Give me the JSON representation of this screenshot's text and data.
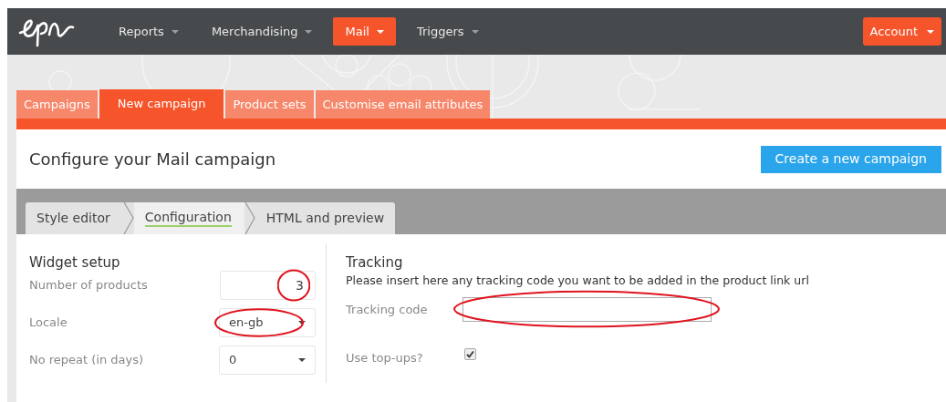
{
  "nav": {
    "items": [
      {
        "label": "Reports",
        "selected": false
      },
      {
        "label": "Merchandising",
        "selected": false
      },
      {
        "label": "Mail",
        "selected": true
      },
      {
        "label": "Triggers",
        "selected": false
      }
    ],
    "account": "Account"
  },
  "tabs": [
    {
      "label": "Campaigns",
      "selected": false
    },
    {
      "label": "New campaign",
      "selected": true
    },
    {
      "label": "Product sets",
      "selected": false
    },
    {
      "label": "Customise email attributes",
      "selected": false
    }
  ],
  "page": {
    "title": "Configure your Mail campaign",
    "create_button": "Create a new campaign"
  },
  "steps": [
    {
      "label": "Style editor",
      "selected": false
    },
    {
      "label": "Configuration",
      "selected": true
    },
    {
      "label": "HTML and preview",
      "selected": false
    }
  ],
  "widget_setup": {
    "title": "Widget setup",
    "fields": [
      {
        "kind": "number",
        "label": "Number of products",
        "value": "3",
        "annotated": true
      },
      {
        "kind": "select",
        "label": "Locale",
        "value": "en-gb",
        "annotated": true
      },
      {
        "kind": "select",
        "label": "No repeat (in days)",
        "value": "0",
        "annotated": false
      }
    ]
  },
  "tracking": {
    "title": "Tracking",
    "description": "Please insert here any tracking code you want to be added in the product link url",
    "fields": [
      {
        "kind": "text",
        "label": "Tracking code",
        "annotated": true
      },
      {
        "kind": "checkbox",
        "label": "Use top-ups?",
        "checked": true
      }
    ]
  }
}
